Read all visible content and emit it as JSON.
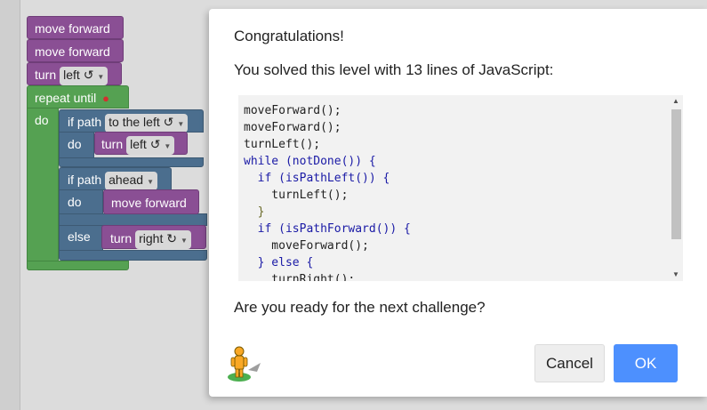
{
  "workspace": {
    "blocks": {
      "move_forward_1": "move forward",
      "move_forward_2": "move forward",
      "turn_label": "turn",
      "turn_field": "left ↺",
      "repeat_label": "repeat until",
      "do_label": "do",
      "if_path_label": "if path",
      "if_path_field": "to the left ↺",
      "inner_do_label": "do",
      "inner_turn_label": "turn",
      "inner_turn_field": "left ↺",
      "if_path2_label": "if path",
      "if_path2_field": "ahead",
      "do2_label": "do",
      "inner_move_forward": "move forward",
      "else_label": "else",
      "else_turn_label": "turn",
      "else_turn_field": "right ↻"
    }
  },
  "dialog": {
    "title": "Congratulations!",
    "solved_message": "You solved this level with 13 lines of JavaScript:",
    "code_lines": [
      "moveForward();",
      "moveForward();",
      "turnLeft();",
      "while (notDone()) {",
      "  if (isPathLeft()) {",
      "    turnLeft();",
      "  }",
      "  if (isPathForward()) {",
      "    moveForward();",
      "  } else {",
      "    turnRight();"
    ],
    "ready_question": "Are you ready for the next challenge?",
    "cancel_label": "Cancel",
    "ok_label": "OK"
  },
  "colors": {
    "ok_button": "#4d90fe",
    "movement_block": "#8a4f94",
    "loop_block": "#55a152",
    "logic_block": "#4b6e8e"
  }
}
